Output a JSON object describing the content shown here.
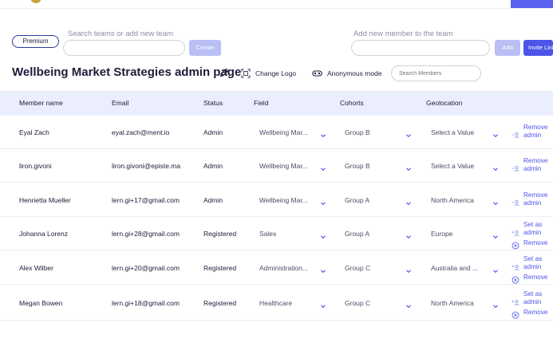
{
  "premium_label": "Premium",
  "team_search": {
    "placeholder": "Search teams or add new team",
    "create_label": "Create"
  },
  "add_member": {
    "placeholder": "Add new member to the team",
    "add_label": "Add",
    "invite_label": "Invite Link"
  },
  "title": "Wellbeing Market Strategies admin page",
  "toolbar": {
    "change_logo": "Change Logo",
    "anonymous_mode": "Anonymous mode",
    "search_placeholder": "Search Members"
  },
  "columns": [
    "Member name",
    "Email",
    "Status",
    "Field",
    "Cohorts",
    "Geolocation"
  ],
  "members": [
    {
      "name": "Eyal Zach",
      "email": "eyal.zach@ment.io",
      "status": "Admin",
      "field": "Wellbeing Mar...",
      "cohort": "Group B",
      "geo": "Select a Value",
      "actions": [
        "Remove admin"
      ]
    },
    {
      "name": "liron.givoni",
      "email": "liron.givoni@episte.ma",
      "status": "Admin",
      "field": "Wellbeing Mar...",
      "cohort": "Group B",
      "geo": "Select a Value",
      "actions": [
        "Remove admin"
      ]
    },
    {
      "name": "Henrietta Mueller",
      "email": "lern.gi+17@gmail.com",
      "status": "Admin",
      "field": "Wellbeing Mar...",
      "cohort": "Group A",
      "geo": "North America",
      "actions": [
        "Remove admin"
      ]
    },
    {
      "name": "Johanna Lorenz",
      "email": "lern.gi+28@gmail.com",
      "status": "Registered",
      "field": "Sales",
      "cohort": "Group A",
      "geo": "Europe",
      "actions": [
        "Set as admin",
        "Remove"
      ]
    },
    {
      "name": "Alex Wilber",
      "email": "lern.gi+20@gmail.com",
      "status": "Registered",
      "field": "Administration...",
      "cohort": "Group C",
      "geo": "Australia and ...",
      "actions": [
        "Set as admin",
        "Remove"
      ]
    },
    {
      "name": "Megan Bowen",
      "email": "lern.gi+18@gmail.com",
      "status": "Registered",
      "field": "Healthcare",
      "cohort": "Group C",
      "geo": "North America",
      "actions": [
        "Set as admin",
        "Remove"
      ]
    }
  ],
  "colors": {
    "accent": "#4b55e8",
    "accent_disabled": "#b9bef5",
    "header_bg": "#ebeefd",
    "text": "#1c1c3a"
  },
  "icons": {
    "edit": "pencil-icon",
    "logo": "image-frame-icon",
    "anonymous": "mask-icon",
    "chevron": "chevron-down-icon",
    "remove_admin": "user-minus-icon",
    "set_admin": "user-plus-icon",
    "remove": "circle-x-icon"
  }
}
